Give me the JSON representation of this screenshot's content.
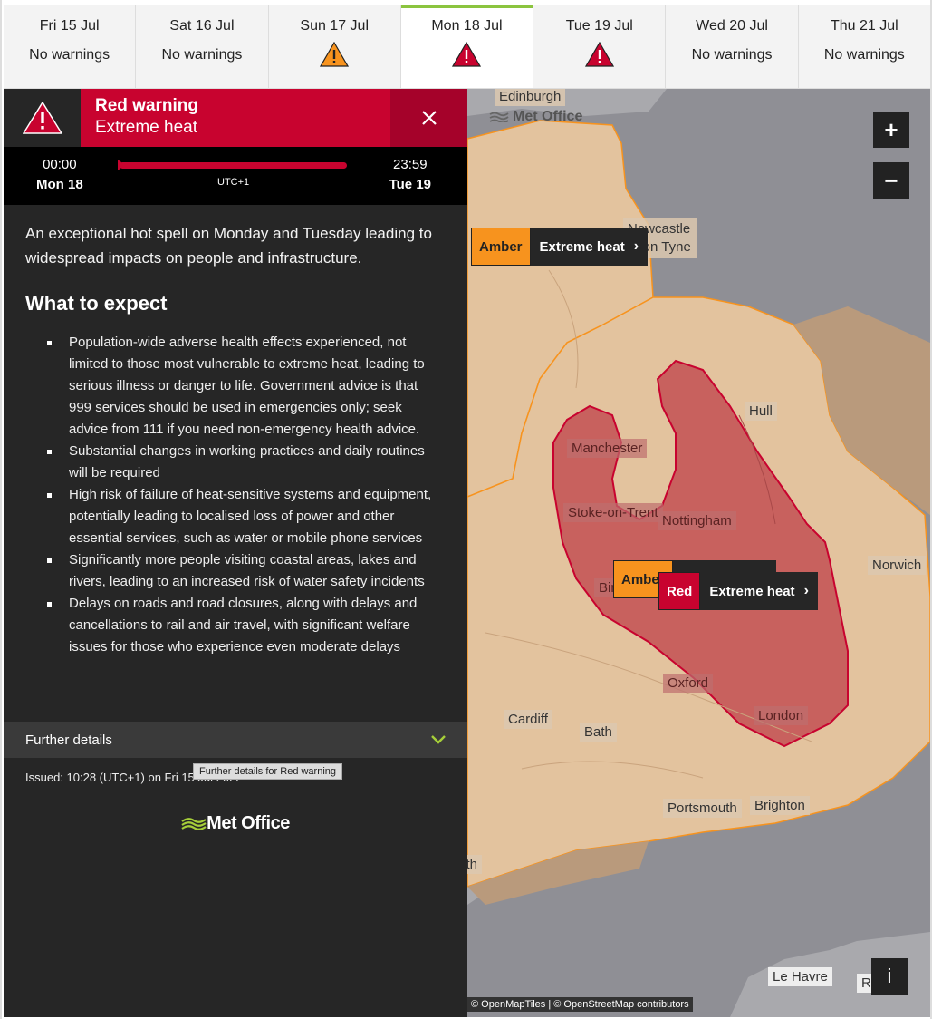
{
  "days": [
    {
      "date": "Fri 15 Jul",
      "status": "No warnings",
      "icon": "none"
    },
    {
      "date": "Sat 16 Jul",
      "status": "No warnings",
      "icon": "none"
    },
    {
      "date": "Sun 17 Jul",
      "status": "",
      "icon": "amber-warning-icon"
    },
    {
      "date": "Mon 18 Jul",
      "status": "",
      "icon": "red-warning-icon",
      "active": true
    },
    {
      "date": "Tue 19 Jul",
      "status": "",
      "icon": "red-warning-icon"
    },
    {
      "date": "Wed 20 Jul",
      "status": "No warnings",
      "icon": "none"
    },
    {
      "date": "Thu 21 Jul",
      "status": "No warnings",
      "icon": "none"
    }
  ],
  "warning": {
    "level": "Red warning",
    "type": "Extreme heat",
    "start_time": "00:00",
    "start_day": "Mon 18",
    "end_time": "23:59",
    "end_day": "Tue 19",
    "timezone": "UTC+1",
    "intro": "An exceptional hot spell on Monday and Tuesday leading to widespread impacts on people and infrastructure.",
    "expect_heading": "What to expect",
    "expect": [
      "Population-wide adverse health effects experienced, not limited to those most vulnerable to extreme heat, leading to serious illness or danger to life. Government advice is that 999 services should be used in emergencies only; seek advice from 111 if you need non-emergency health advice.",
      "Substantial changes in working practices and daily routines will be required",
      "High risk of failure of heat-sensitive systems and equipment, potentially leading to localised loss of power and other essential services, such as water or mobile phone services",
      "Significantly more people visiting coastal areas, lakes and rivers, leading to an increased risk of water safety incidents",
      "Delays on roads and road closures, along with delays and cancellations to rail and air travel, with significant welfare issues for those who experience even moderate delays"
    ],
    "further_details": "Further details",
    "issued": "Issued: 10:28 (UTC+1) on Fri 15 Jul 2022",
    "tooltip": "Further details for Red warning",
    "logo": "Met Office"
  },
  "map": {
    "zoom_in": "+",
    "zoom_out": "−",
    "info": "i",
    "attribution": "© OpenMapTiles | © OpenStreetMap contributors",
    "brand": "Met Office",
    "cities": [
      "Edinburgh",
      "Newcastle upon Tyne",
      "Hull",
      "Manchester",
      "Stoke-on-Trent",
      "Nottingham",
      "Norwich",
      "Birmingham",
      "Oxford",
      "London",
      "Cardiff",
      "Bath",
      "Portsmouth",
      "Brighton",
      "Plymouth",
      "Le Havre",
      "Rouen"
    ],
    "chips": [
      {
        "level": "Amber",
        "type": "Extreme heat"
      },
      {
        "level": "Amber",
        "type": "Extreme heat"
      },
      {
        "level": "Red",
        "type": "Extreme heat"
      }
    ],
    "colors": {
      "red": "#c8032f",
      "amber": "#f7931e",
      "land": "#e3c39e"
    }
  }
}
